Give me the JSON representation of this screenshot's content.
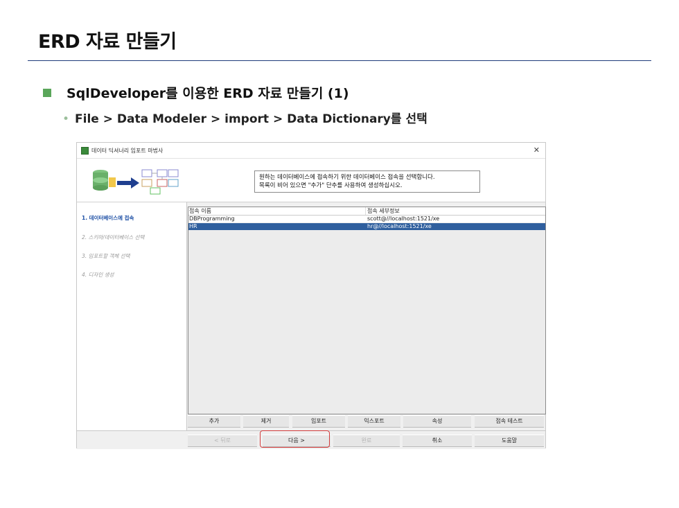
{
  "slide": {
    "title": "ERD 자료 만들기",
    "bullet1": "SqlDeveloper를 이용한 ERD 자료 만들기 (1)",
    "bullet2": "File > Data Modeler > import > Data Dictionary를 선택"
  },
  "dialog": {
    "window_title": "데이터 딕셔너리 임포트 마법사",
    "close_icon": "close-icon",
    "banner_line1": "원하는 데이터베이스에 접속하기 위한 데이터베이스 접속을 선택합니다.",
    "banner_line2": "목록이 비어 있으면 \"추가\" 단추를 사용하여 생성하십시오.",
    "steps": [
      {
        "label": "1. 데이터베이스에 접속",
        "active": true
      },
      {
        "label": "2. 스키마/데이터베이스 선택",
        "active": false
      },
      {
        "label": "3. 임포트할 객체 선택",
        "active": false
      },
      {
        "label": "4. 디자인 생성",
        "active": false
      }
    ],
    "table": {
      "columns": [
        "접속 이름",
        "접속 세부정보"
      ],
      "rows": [
        {
          "name": "DBProgramming",
          "details": "scott@//localhost:1521/xe",
          "selected": false
        },
        {
          "name": "HR",
          "details": "hr@//localhost:1521/xe",
          "selected": true
        }
      ]
    },
    "table_buttons": [
      "추가",
      "제거",
      "임포트",
      "익스포트",
      "속성",
      "접속 테스트"
    ],
    "footer_buttons": [
      {
        "label": "< 뒤로",
        "enabled": false
      },
      {
        "label": "다음 >",
        "enabled": true
      },
      {
        "label": "완료",
        "enabled": false
      },
      {
        "label": "취소",
        "enabled": true
      },
      {
        "label": "도움말",
        "enabled": true
      }
    ],
    "highlight_color": "#d23b3b",
    "selection_color": "#2f5f9e",
    "accent_color": "#1d4fa5"
  }
}
